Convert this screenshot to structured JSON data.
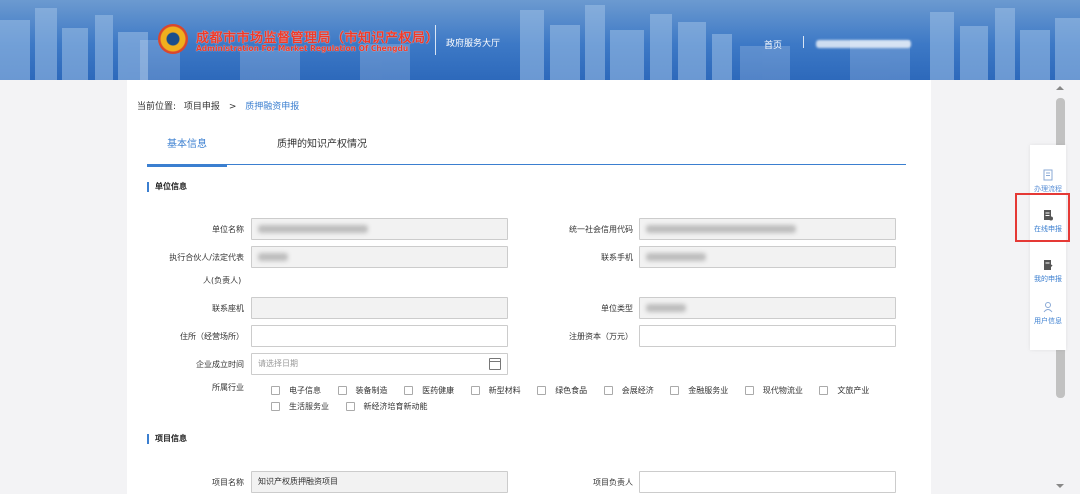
{
  "header": {
    "org_cn": "成都市市场监督管理局（市知识产权局）",
    "org_en": "Administration For Market Regulation Of Chengdu",
    "hall": "政府服务大厅",
    "home": "首页"
  },
  "breadcrumb": {
    "prefix": "当前位置:",
    "item1": "项目申报",
    "sep": ">",
    "current": "质押融资申报"
  },
  "tabs": [
    {
      "label": "基本信息",
      "active": true
    },
    {
      "label": "质押的知识产权情况",
      "active": false
    }
  ],
  "sections": {
    "unit_info": "单位信息",
    "project_info": "项目信息"
  },
  "form": {
    "unit_name": {
      "label": "单位名称",
      "value": ""
    },
    "credit_code": {
      "label": "统一社会信用代码",
      "value": ""
    },
    "legal_rep_label_1": "执行合伙人/法定代表",
    "legal_rep_label_2": "人(负责人)",
    "legal_rep": {
      "value": ""
    },
    "mobile": {
      "label": "联系手机",
      "value": ""
    },
    "phone": {
      "label": "联系座机",
      "value": ""
    },
    "unit_type": {
      "label": "单位类型",
      "value": ""
    },
    "address": {
      "label": "住所（经营场所）",
      "value": ""
    },
    "capital": {
      "label": "注册资本（万元）",
      "value": ""
    },
    "founded": {
      "label": "企业成立时间",
      "placeholder": "请选择日期"
    },
    "industry": {
      "label": "所属行业"
    },
    "project_name": {
      "label": "项目名称",
      "value": "知识产权质押融资项目"
    },
    "project_lead": {
      "label": "项目负责人",
      "value": ""
    }
  },
  "industries": [
    "电子信息",
    "装备制造",
    "医药健康",
    "新型材料",
    "绿色食品",
    "会展经济",
    "金融服务业",
    "现代物流业",
    "文旅产业",
    "生活服务业",
    "新经济培育新动能"
  ],
  "side_panel": [
    {
      "label": "办理流程",
      "icon": "document-icon"
    },
    {
      "label": "在线申报",
      "icon": "form-icon"
    },
    {
      "label": "我的申报",
      "icon": "edit-doc-icon"
    },
    {
      "label": "用户信息",
      "icon": "user-icon"
    }
  ],
  "colors": {
    "accent": "#3b7fd0",
    "highlight": "#e53935",
    "org_red": "#f03a28"
  }
}
